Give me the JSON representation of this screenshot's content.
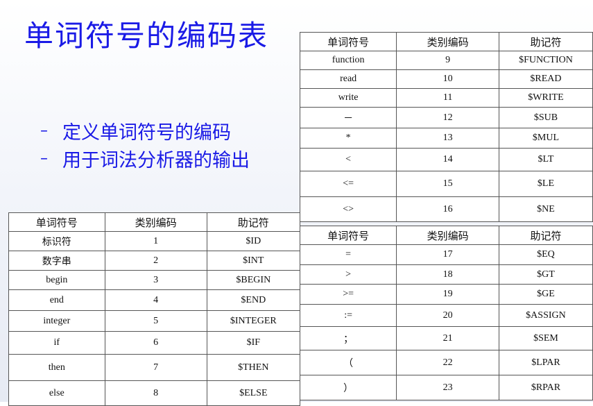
{
  "title": "单词符号的编码表",
  "bullets": [
    "定义单词符号的编码",
    "用于词法分析器的输出"
  ],
  "headers": [
    "单词符号",
    "类别编码",
    "助记符"
  ],
  "table_top_right": [
    [
      "function",
      "9",
      "$FUNCTION"
    ],
    [
      "read",
      "10",
      "$READ"
    ],
    [
      "write",
      "11",
      "$WRITE"
    ],
    [
      "－",
      "12",
      "$SUB"
    ],
    [
      "*",
      "13",
      "$MUL"
    ],
    [
      "<",
      "14",
      "$LT"
    ],
    [
      "<=",
      "15",
      "$LE"
    ],
    [
      "<>",
      "16",
      "$NE"
    ]
  ],
  "table_bottom_left": [
    [
      "标识符",
      "1",
      "$ID"
    ],
    [
      "数字串",
      "2",
      "$INT"
    ],
    [
      "begin",
      "3",
      "$BEGIN"
    ],
    [
      "end",
      "4",
      "$END"
    ],
    [
      "integer",
      "5",
      "$INTEGER"
    ],
    [
      "if",
      "6",
      "$IF"
    ],
    [
      "then",
      "7",
      "$THEN"
    ],
    [
      "else",
      "8",
      "$ELSE"
    ]
  ],
  "table_bottom_right": [
    [
      "=",
      "17",
      "$EQ"
    ],
    [
      ">",
      "18",
      "$GT"
    ],
    [
      ">=",
      "19",
      "$GE"
    ],
    [
      ":=",
      "20",
      "$ASSIGN"
    ],
    [
      "；",
      "21",
      "$SEM"
    ],
    [
      "（",
      "22",
      "$LPAR"
    ],
    [
      "）",
      "23",
      "$RPAR"
    ]
  ]
}
